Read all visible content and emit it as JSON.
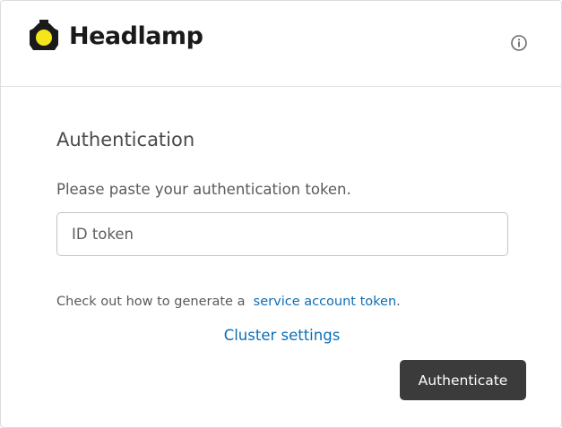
{
  "header": {
    "brand": "Headlamp",
    "logo_icon": "headlamp-logo-icon",
    "info_icon": "info-icon"
  },
  "main": {
    "title": "Authentication",
    "subtitle": "Please paste your authentication token.",
    "token_input": {
      "placeholder": "ID token",
      "value": ""
    },
    "hint_prefix": "Check out how to generate a",
    "hint_link": "service account token",
    "hint_suffix": ".",
    "cluster_settings_label": "Cluster settings",
    "authenticate_label": "Authenticate"
  },
  "colors": {
    "link": "#0d6eb6",
    "button_bg": "#3b3b3b",
    "logo_yellow": "#f5e61c"
  }
}
